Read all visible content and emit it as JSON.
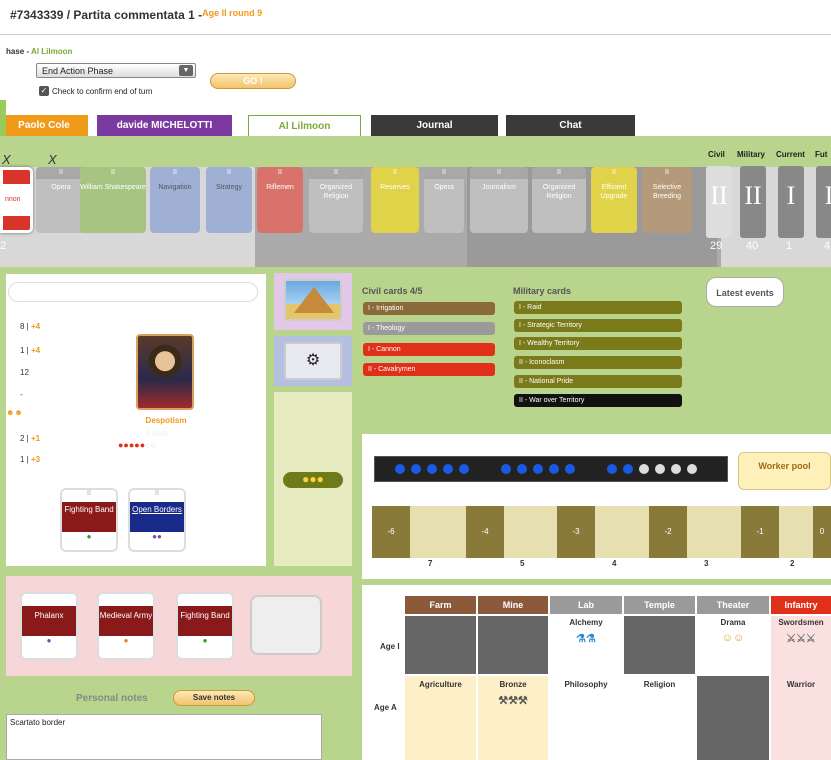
{
  "header": {
    "title": "#7343339 / Partita commentata 1 - ",
    "age_round": "Age II round 9"
  },
  "phase": {
    "label": "hase - ",
    "player": "Al Lilmoon",
    "select_value": "End Action Phase",
    "confirm_label": "Check to confirm end of turn",
    "go_label": "GO !"
  },
  "tabs": [
    "Paolo Cole",
    "davide MICHELOTTI",
    "Al Lilmoon",
    "Journal",
    "Chat"
  ],
  "card_row": {
    "selected": "nnon",
    "cards": [
      {
        "age": "II",
        "name": "Opera",
        "color": "gray"
      },
      {
        "age": "II",
        "name": "William Shakespeare",
        "color": "green"
      },
      {
        "age": "II",
        "name": "Navigation",
        "color": "blue"
      },
      {
        "age": "II",
        "name": "Strategy",
        "color": "blue"
      },
      {
        "age": "II",
        "name": "Riflemen",
        "color": "red"
      },
      {
        "age": "II",
        "name": "Organized Religion",
        "color": "gray"
      },
      {
        "age": "II",
        "name": "Reserves",
        "color": "yellow"
      },
      {
        "age": "II",
        "name": "Opera",
        "color": "gray"
      },
      {
        "age": "II",
        "name": "Journalism",
        "color": "gray"
      },
      {
        "age": "II",
        "name": "Organized Religion",
        "color": "gray"
      },
      {
        "age": "II",
        "name": "Efficient Upgrade",
        "color": "yellow"
      },
      {
        "age": "II",
        "name": "Selective Breeding",
        "color": "brown"
      }
    ],
    "marks": [
      "X",
      "X"
    ],
    "left_value": "2",
    "points": [
      {
        "label": "Civil",
        "value": "29",
        "numeral": "II"
      },
      {
        "label": "Military",
        "value": "40",
        "numeral": "II"
      },
      {
        "label": "Current",
        "value": "1",
        "numeral": "I"
      },
      {
        "label": "Fut",
        "value": "4",
        "numeral": "I"
      }
    ]
  },
  "player": {
    "stats": [
      {
        "text": "8 | ",
        "extra": "+4"
      },
      {
        "text": "1 | ",
        "extra": "+4"
      },
      {
        "text": "12",
        "extra": ""
      },
      {
        "text": "-",
        "extra": ""
      },
      {
        "text": "2 | ",
        "extra": "+1"
      },
      {
        "text": "1 | ",
        "extra": "+3"
      }
    ],
    "government": "Despotism",
    "leaders": [
      {
        "age": "II",
        "name": "Fighting Band",
        "color": "#8a1a1a"
      },
      {
        "age": "II",
        "name": "Open Borders",
        "color": "#1a2a8a"
      }
    ]
  },
  "units": [
    {
      "age": "II",
      "name": "Phalanx"
    },
    {
      "age": "II",
      "name": "Medieval Army"
    },
    {
      "age": "II",
      "name": "Fighting Band"
    }
  ],
  "notes": {
    "label": "Personal notes",
    "save": "Save notes",
    "text": "Scartato border"
  },
  "civil": {
    "title": "Civil cards 4/5",
    "items": [
      {
        "text": "I - Irrigation",
        "color": "#8a6a3a"
      },
      {
        "text": "I - Theology",
        "color": "#9a9a9a"
      },
      {
        "text": "I - Cannon",
        "color": "#e0301a"
      },
      {
        "text": "II - Cavalrymen",
        "color": "#e0301a"
      }
    ]
  },
  "military": {
    "title": "Military cards",
    "items": [
      {
        "text": "I - Raid",
        "color": "#7a7a1a"
      },
      {
        "text": "I - Strategic Territory",
        "color": "#7a7a1a"
      },
      {
        "text": "I - Wealthy Territory",
        "color": "#7a7a1a"
      },
      {
        "text": "II - Iconoclasm",
        "color": "#7a7a1a"
      },
      {
        "text": "II - National Pride",
        "color": "#7a7a1a"
      },
      {
        "text": "II - War over Territory",
        "color": "#111111"
      }
    ]
  },
  "latest_events": "Latest events",
  "worker_pool": "Worker pool",
  "food_labels": [
    "-6",
    "-4",
    "-3",
    "-2",
    "-1",
    "0"
  ],
  "food_bottom": [
    "7",
    "5",
    "4",
    "3",
    "2"
  ],
  "tech": {
    "headers": [
      {
        "name": "Farm",
        "color": "#8a5a3a"
      },
      {
        "name": "Mine",
        "color": "#8a5a3a"
      },
      {
        "name": "Lab",
        "color": "#9a9a9a"
      },
      {
        "name": "Temple",
        "color": "#9a9a9a"
      },
      {
        "name": "Theater",
        "color": "#9a9a9a"
      },
      {
        "name": "Infantry",
        "color": "#e0301a"
      }
    ],
    "rows": [
      {
        "age": "Age I",
        "cells": [
          "",
          "",
          "Alchemy",
          "",
          "Drama",
          "Swordsmen"
        ]
      },
      {
        "age": "Age A",
        "cells": [
          "Agriculture",
          "Bronze",
          "Philosophy",
          "Religion",
          "",
          "Warrior"
        ]
      }
    ]
  }
}
